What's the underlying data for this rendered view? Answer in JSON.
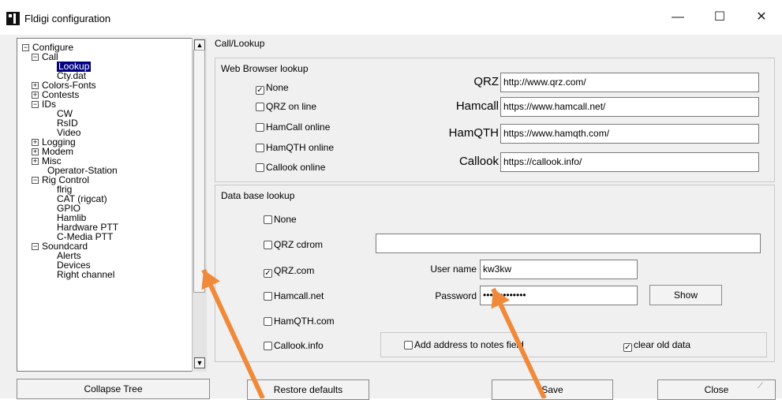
{
  "window": {
    "title": "Fldigi configuration",
    "minimize": "—",
    "maximize": "☐",
    "close": "✕"
  },
  "tree": {
    "items": [
      {
        "label": "Configure",
        "toggle": "−"
      },
      {
        "label": "Call",
        "toggle": "−"
      },
      {
        "label": "Lookup",
        "selected": true
      },
      {
        "label": "Cty.dat"
      },
      {
        "label": "Colors-Fonts",
        "toggle": "+"
      },
      {
        "label": "Contests",
        "toggle": "+"
      },
      {
        "label": "IDs",
        "toggle": "−"
      },
      {
        "label": "CW"
      },
      {
        "label": "RsID"
      },
      {
        "label": "Video"
      },
      {
        "label": "Logging",
        "toggle": "+"
      },
      {
        "label": "Modem",
        "toggle": "+"
      },
      {
        "label": "Misc",
        "toggle": "+"
      },
      {
        "label": "Operator-Station"
      },
      {
        "label": "Rig Control",
        "toggle": "−"
      },
      {
        "label": "flrig"
      },
      {
        "label": "CAT (rigcat)"
      },
      {
        "label": "GPIO"
      },
      {
        "label": "Hamlib"
      },
      {
        "label": "Hardware PTT"
      },
      {
        "label": "C-Media PTT"
      },
      {
        "label": "Soundcard",
        "toggle": "−"
      },
      {
        "label": "Alerts"
      },
      {
        "label": "Devices"
      },
      {
        "label": "Right channel"
      }
    ],
    "scroll_up": "▲",
    "scroll_down": "▼"
  },
  "panel": {
    "title": "Call/Lookup",
    "web": {
      "label": "Web Browser lookup",
      "options": [
        {
          "label": "None",
          "checked": true
        },
        {
          "label": "QRZ on line",
          "checked": false
        },
        {
          "label": "HamCall online",
          "checked": false
        },
        {
          "label": "HamQTH online",
          "checked": false
        },
        {
          "label": "Callook online",
          "checked": false
        }
      ],
      "urls": [
        {
          "label": "QRZ",
          "value": "http://www.qrz.com/"
        },
        {
          "label": "Hamcall",
          "value": "https://www.hamcall.net/"
        },
        {
          "label": "HamQTH",
          "value": "https://www.hamqth.com/"
        },
        {
          "label": "Callook",
          "value": "https://callook.info/"
        }
      ]
    },
    "db": {
      "label": "Data base lookup",
      "options": [
        {
          "label": "None",
          "checked": false
        },
        {
          "label": "QRZ cdrom",
          "checked": false
        },
        {
          "label": "QRZ.com",
          "checked": true
        },
        {
          "label": "Hamcall.net",
          "checked": false
        },
        {
          "label": "HamQTH.com",
          "checked": false
        },
        {
          "label": "Callook.info",
          "checked": false
        }
      ],
      "cdrom_path": "",
      "username_label": "User name",
      "username": "kw3kw",
      "password_label": "Password",
      "password": "•••••••••••••",
      "show_button": "Show",
      "add_address_label": "Add address to notes field",
      "add_address_checked": false,
      "clear_old_label": "clear old data",
      "clear_old_checked": true
    }
  },
  "buttons": {
    "collapse_tree": "Collapse Tree",
    "restore_defaults": "Restore defaults",
    "save": "Save",
    "close": "Close"
  },
  "annotation_color": "#f08a3a"
}
